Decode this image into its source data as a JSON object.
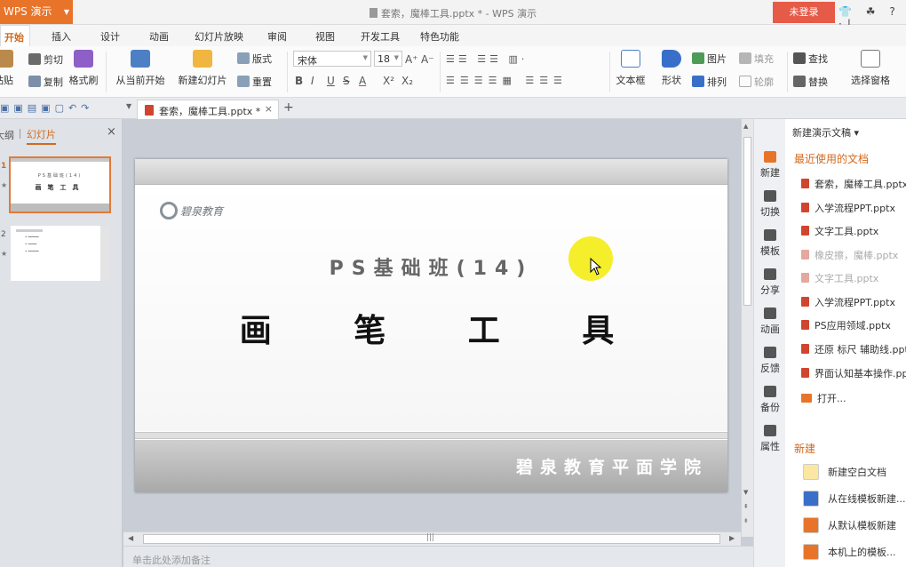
{
  "app": {
    "name": "WPS 演示",
    "window_title": "套索，魔棒工具.pptx * - WPS 演示",
    "login_label": "未登录",
    "toolbar_glyphs": "👕 ☘ ?·|"
  },
  "menu_tabs": [
    "开始",
    "插入",
    "设计",
    "动画",
    "幻灯片放映",
    "审阅",
    "视图",
    "开发工具",
    "特色功能"
  ],
  "ribbon": {
    "paste": "粘贴",
    "cut": "剪切",
    "copy": "复制",
    "format_painter": "格式刷",
    "from_current": "从当前开始",
    "new_slide": "新建幻灯片",
    "layout": "版式",
    "reset": "重置",
    "font_name": "宋体",
    "font_size": "18",
    "bold": "B",
    "italic": "I",
    "underline": "U",
    "strike": "S",
    "font_color": "A",
    "superscript": "X²",
    "subscript": "X₂",
    "textbox": "文本框",
    "shape": "形状",
    "picture": "图片",
    "arrange": "排列",
    "fill": "填充",
    "outline": "轮廓",
    "find": "查找",
    "replace": "替换",
    "select_pane": "选择窗格"
  },
  "doc_tab": {
    "label": "套索，魔棒工具.pptx *",
    "close": "×",
    "add": "+"
  },
  "left_panel": {
    "tab_outline": "大纲",
    "tab_slides": "幻灯片",
    "close": "×",
    "slide_numbers": [
      "1",
      "2"
    ],
    "thumb1_sub": "PS基础班(14)",
    "thumb1_title": "画笔工具"
  },
  "slide": {
    "logo_text": "碧泉教育",
    "subtitle": "PS基础班(14)",
    "title": "画 笔 工 具",
    "footer": "碧泉教育平面学院"
  },
  "notes_placeholder": "单击此处添加备注",
  "right_sidebar": [
    {
      "label": "新建",
      "active": true
    },
    {
      "label": "切换",
      "active": false
    },
    {
      "label": "模板",
      "active": false
    },
    {
      "label": "分享",
      "active": false
    },
    {
      "label": "动画",
      "active": false
    },
    {
      "label": "反馈",
      "active": false
    },
    {
      "label": "备份",
      "active": false
    },
    {
      "label": "属性",
      "active": false
    }
  ],
  "task_pane": {
    "header": "新建演示文稿 ▾",
    "recent_title": "最近使用的文档",
    "recent_files": [
      {
        "name": "套索，魔棒工具.pptx",
        "dim": false
      },
      {
        "name": "入学流程PPT.pptx",
        "dim": false
      },
      {
        "name": "文字工具.pptx",
        "dim": false
      },
      {
        "name": "橡皮擦，魔棒.pptx",
        "dim": true
      },
      {
        "name": "文字工具.pptx",
        "dim": true
      },
      {
        "name": "入学流程PPT.pptx",
        "dim": false
      },
      {
        "name": "PS应用领域.pptx",
        "dim": false
      },
      {
        "name": "还原 标尺 辅助线.pptx",
        "dim": false
      },
      {
        "name": "界面认知基本操作.pptx",
        "dim": false
      }
    ],
    "open_label": "打开...",
    "new_title": "新建",
    "new_options": [
      "新建空白文档",
      "从在线模板新建...",
      "从默认模板新建",
      "本机上的模板..."
    ]
  },
  "colors": {
    "accent": "#e8742a",
    "login": "#e55b48",
    "highlight": "#f4ec14"
  }
}
